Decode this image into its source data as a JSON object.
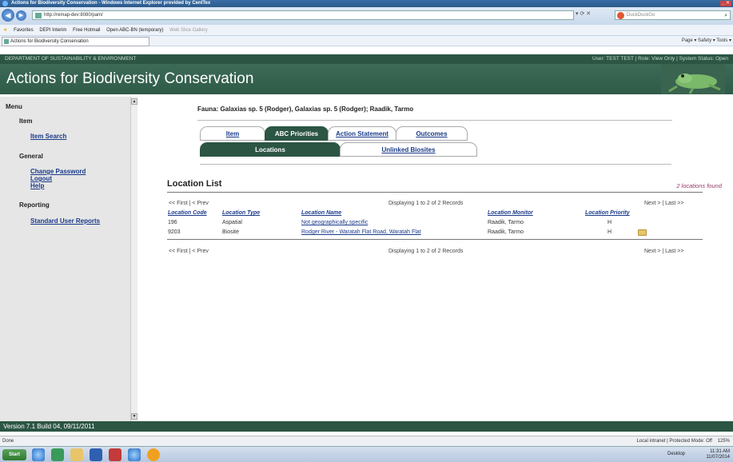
{
  "browser": {
    "title": "Actions for Biodiversity Conservation - Windows Internet Explorer provided by CenITex",
    "url": "http://remap-dev:8080/pam/",
    "search_placeholder": "DuckDuckGo",
    "favorites_label": "Favorites",
    "favorites": [
      "DEPI Interim",
      "Free Hotmail",
      "Open ABC-BN (temporary)",
      "Web Slice Gallery"
    ],
    "tab_label": "Actions for Biodiversity Conservation",
    "command_bar": "Page ▾  Safety ▾  Tools ▾",
    "status_left": "Done",
    "status_right": "Local intranet | Protected Mode: Off",
    "zoom": "125%"
  },
  "header": {
    "department": "DEPARTMENT OF SUSTAINABILITY & ENVIRONMENT",
    "user_info": "User: TEST TEST  |  Role: View Only  |  System Status: Open",
    "app_title": "Actions for Biodiversity Conservation"
  },
  "menu": {
    "title": "Menu",
    "sections": [
      {
        "label": "Item",
        "links": [
          "Item Search"
        ]
      },
      {
        "label": "General",
        "links": [
          "Change Password",
          "Logout",
          "Help"
        ]
      },
      {
        "label": "Reporting",
        "links": [
          "Standard User Reports"
        ]
      }
    ]
  },
  "main": {
    "fauna": "Fauna: Galaxias sp. 5 (Rodger), Galaxias sp. 5 (Rodger); Raadik, Tarmo",
    "tabs_top": [
      "Item",
      "ABC Priorities",
      "Action Statement",
      "Outcomes"
    ],
    "tabs_sub": [
      "Locations",
      "Unlinked Biosites"
    ],
    "list_title": "Location List",
    "found": "2 locations found",
    "pager_left": "<< First  |  < Prev",
    "pager_center": "Displaying 1 to 2 of 2 Records",
    "pager_right": "Next >  |  Last >>",
    "columns": [
      "Location Code",
      "Location Type",
      "Location Name",
      "Location Monitor",
      "Location Priority"
    ],
    "rows": [
      {
        "code": "196",
        "type": "Aspatial",
        "name": "Not geographically specific",
        "monitor": "Raadik, Tarmo",
        "priority": "H"
      },
      {
        "code": "9203",
        "type": "Biosite",
        "name": "Rodger River - Waratah Flat Road, Waratah Flat",
        "monitor": "Raadik, Tarmo",
        "priority": "H"
      }
    ]
  },
  "footer": {
    "version": "Version 7.1 Build 04, 09/11/2011"
  },
  "taskbar": {
    "start": "Start",
    "desktop": "Desktop",
    "time": "11:31 AM",
    "date": "11/07/2014"
  }
}
